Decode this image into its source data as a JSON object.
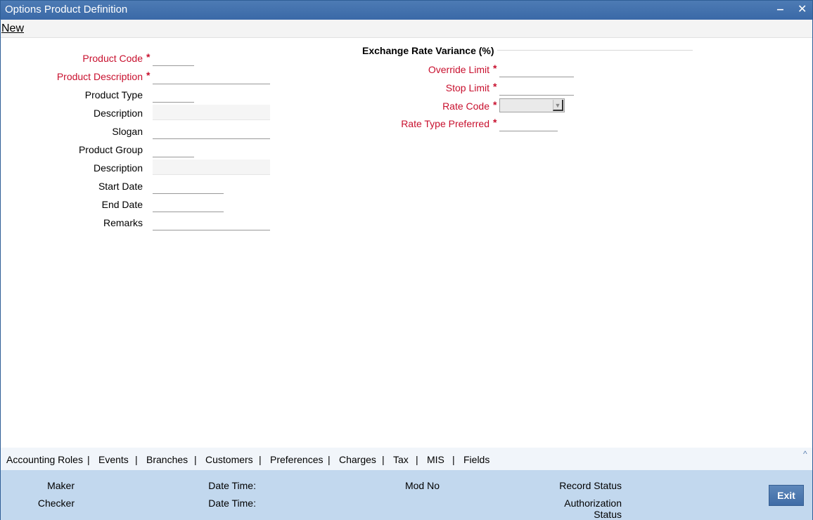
{
  "window": {
    "title": "Options Product Definition",
    "minimize_glyph": "‒",
    "close_glyph": "✕"
  },
  "toolbar": {
    "new_label": "New"
  },
  "left_form": {
    "product_code": "Product Code",
    "product_description": "Product Description",
    "product_type": "Product Type",
    "description1": "Description",
    "slogan": "Slogan",
    "product_group": "Product Group",
    "description2": "Description",
    "start_date": "Start Date",
    "end_date": "End Date",
    "remarks": "Remarks"
  },
  "exchange": {
    "title": "Exchange Rate Variance (%)",
    "override_limit": "Override Limit",
    "stop_limit": "Stop Limit",
    "rate_code": "Rate Code",
    "rate_type_preferred": "Rate Type Preferred"
  },
  "required_mark": "*",
  "tabs": {
    "items": [
      "Accounting Roles",
      "Events",
      "Branches",
      "Customers",
      "Preferences",
      "Charges",
      "Tax",
      "MIS",
      "Fields"
    ],
    "separator": "|",
    "caret": "^"
  },
  "footer": {
    "maker": "Maker",
    "checker": "Checker",
    "date_time1": "Date Time:",
    "date_time2": "Date Time:",
    "mod_no": "Mod No",
    "record_status": "Record Status",
    "authorization": "Authorization",
    "status": "Status",
    "exit_label": "Exit"
  },
  "colors": {
    "title_bar": "#3a69a7",
    "required": "#c8102e",
    "footer": "#c2d8ee",
    "exit_button": "#4a77b0"
  }
}
